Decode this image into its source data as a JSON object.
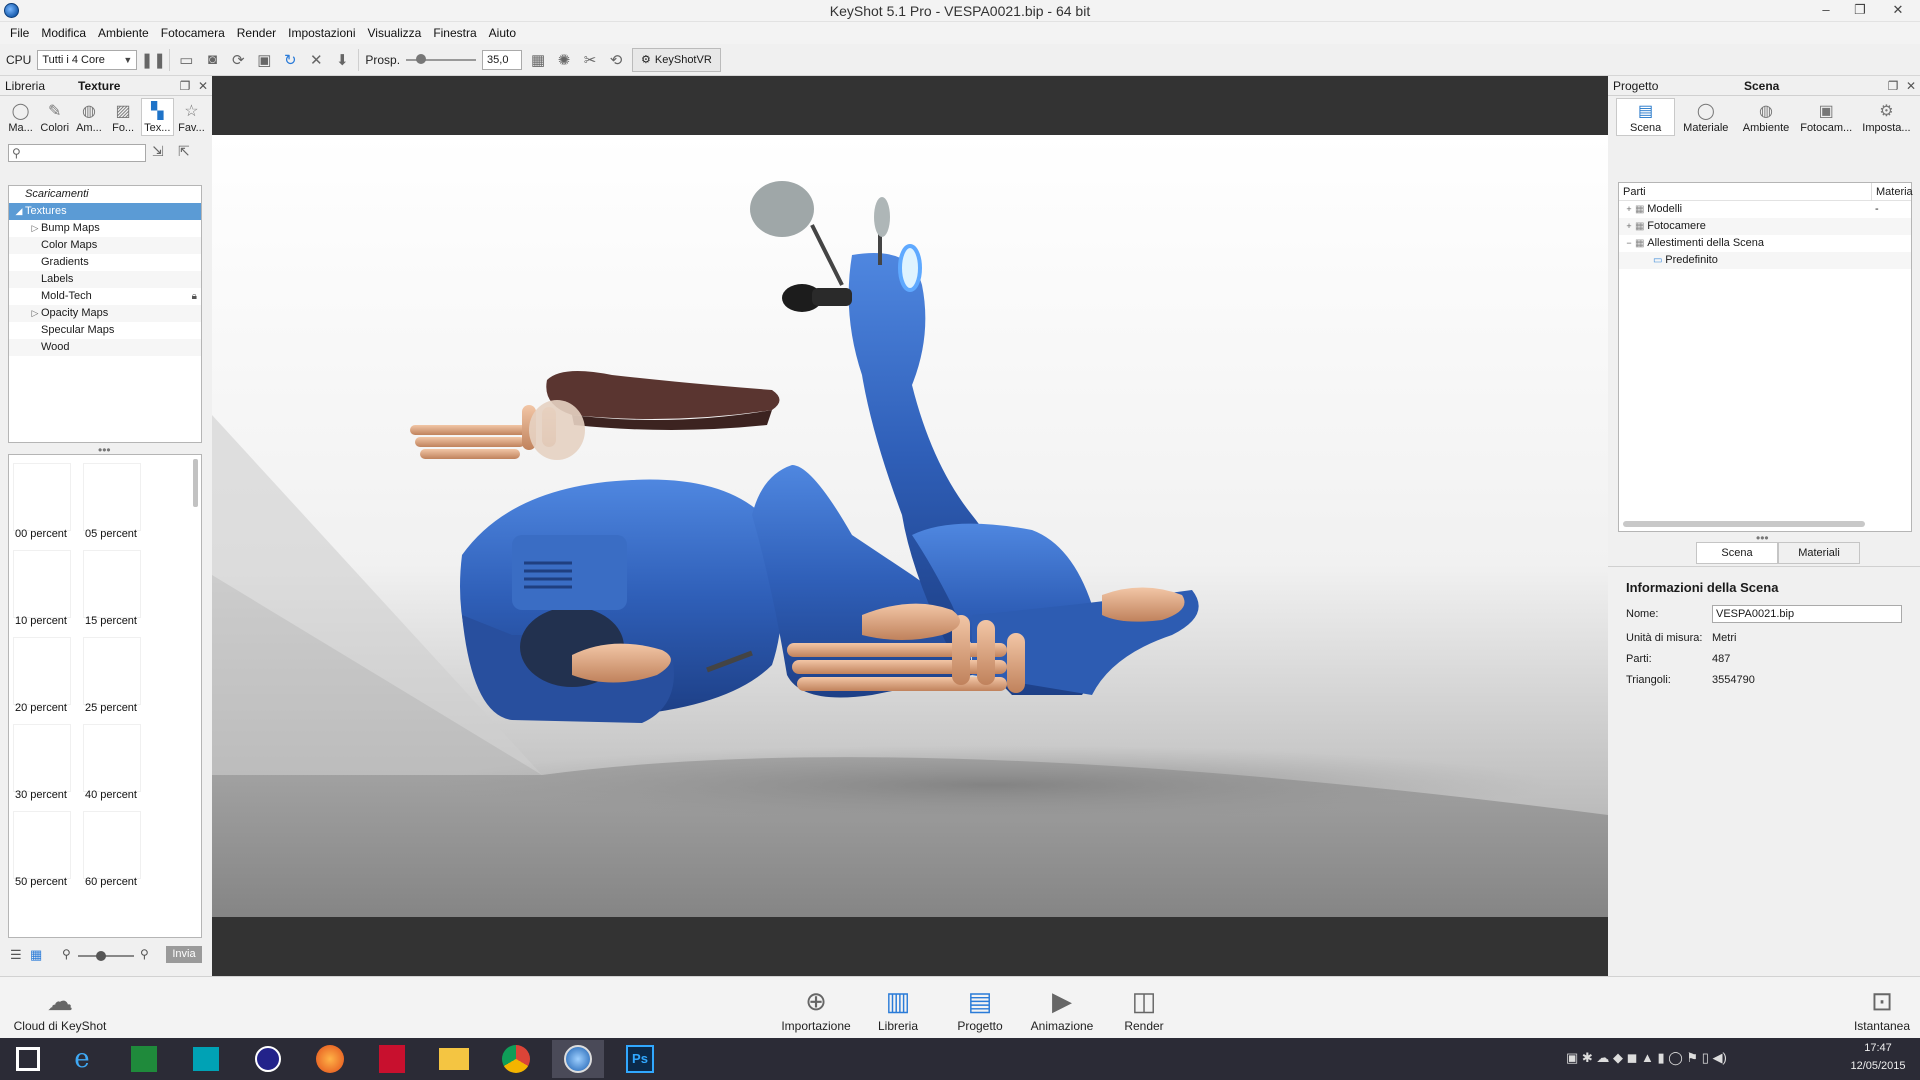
{
  "window": {
    "title": "KeyShot 5.1 Pro  - VESPA0021.bip  - 64 bit",
    "controls": [
      "–",
      "❐",
      "✕"
    ]
  },
  "menu": [
    "File",
    "Modifica",
    "Ambiente",
    "Fotocamera",
    "Render",
    "Impostazioni",
    "Visualizza",
    "Finestra",
    "Aiuto"
  ],
  "toolbar": {
    "cpu_label": "CPU",
    "cpu_select": "Tutti i 4 Core",
    "persp_label": "Prosp.",
    "persp_value": "35,0",
    "vr_label": "KeyShotVR"
  },
  "library": {
    "header_left": "Libreria",
    "header_title": "Texture",
    "tabs": [
      "Ma...",
      "Colori",
      "Am...",
      "Fo...",
      "Tex...",
      "Fav..."
    ],
    "active_tab": 4,
    "search_placeholder": "",
    "tree": [
      {
        "label": "Scaricamenti",
        "level": 0,
        "italic": true,
        "expander": ""
      },
      {
        "label": "Textures",
        "level": 0,
        "selected": true,
        "expander": "◢"
      },
      {
        "label": "Bump Maps",
        "level": 1,
        "expander": "▷"
      },
      {
        "label": "Color Maps",
        "level": 1,
        "expander": ""
      },
      {
        "label": "Gradients",
        "level": 1,
        "expander": ""
      },
      {
        "label": "Labels",
        "level": 1,
        "expander": ""
      },
      {
        "label": "Mold-Tech",
        "level": 1,
        "expander": "",
        "locked": true
      },
      {
        "label": "Opacity Maps",
        "level": 1,
        "expander": "▷"
      },
      {
        "label": "Specular Maps",
        "level": 1,
        "expander": ""
      },
      {
        "label": "Wood",
        "level": 1,
        "expander": ""
      }
    ],
    "thumbnails": [
      "00 percent",
      "05 percent",
      "10 percent",
      "15 percent",
      "20 percent",
      "25 percent",
      "30 percent",
      "40 percent",
      "50 percent",
      "60 percent"
    ],
    "send_label": "Invia"
  },
  "project": {
    "header_left": "Progetto",
    "header_title": "Scena",
    "tabs": [
      "Scena",
      "Materiale",
      "Ambiente",
      "Fotocam...",
      "Imposta..."
    ],
    "active_tab": 0,
    "tree_headers": [
      "Parti",
      "Materia"
    ],
    "tree": [
      {
        "label": "Modelli",
        "expander": "+",
        "material": "-",
        "level": 0
      },
      {
        "label": "Fotocamere",
        "expander": "+",
        "material": "",
        "level": 0
      },
      {
        "label": "Allestimenti della Scena",
        "expander": "−",
        "material": "",
        "level": 0
      },
      {
        "label": "Predefinito",
        "expander": "",
        "material": "",
        "level": 1
      }
    ],
    "subtabs": [
      "Scena",
      "Materiali"
    ],
    "info_title": "Informazioni della Scena",
    "info": {
      "name_label": "Nome:",
      "name_value": "VESPA0021.bip",
      "units_label": "Unità di misura:",
      "units_value": "Metri",
      "parts_label": "Parti:",
      "parts_value": "487",
      "tri_label": "Triangoli:",
      "tri_value": "3554790"
    }
  },
  "ribbon": {
    "cloud": "Cloud di KeyShot",
    "buttons": [
      "Importazione",
      "Libreria",
      "Progetto",
      "Animazione",
      "Render"
    ],
    "snapshot": "Istantanea"
  },
  "taskbar": {
    "time": "17:47",
    "date": "12/05/2015"
  },
  "colors": {
    "accent": "#2a7bd8",
    "selection": "#5b9bd5",
    "viewport_frame": "#333333",
    "vespa_blue": "#2f5fb8"
  }
}
